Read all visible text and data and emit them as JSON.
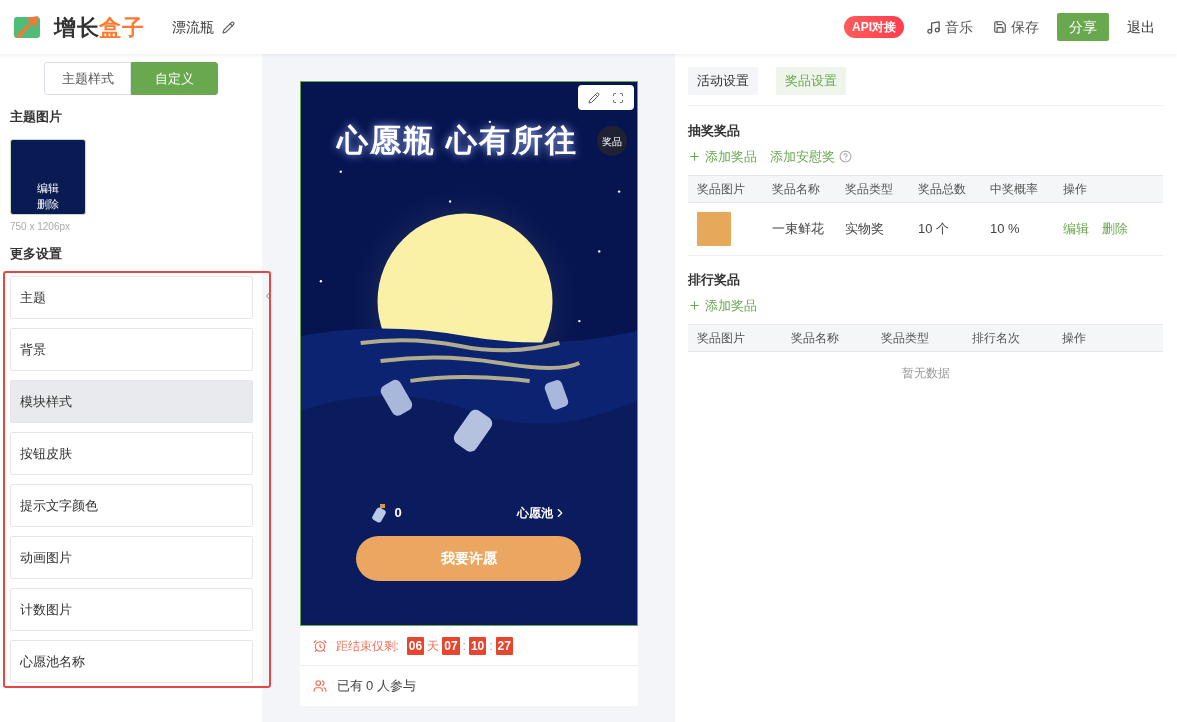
{
  "header": {
    "logo": {
      "part_1": "增长",
      "part_2": "盒子"
    },
    "project_title": "漂流瓶",
    "api_badge": "API对接",
    "music": "音乐",
    "save": "保存",
    "share": "分享",
    "exit": "退出"
  },
  "left_panel": {
    "tabs": [
      {
        "label": "主题样式",
        "selected": false
      },
      {
        "label": "自定义",
        "selected": true
      }
    ],
    "theme_image": {
      "title": "主题图片",
      "actions": [
        "编辑",
        "删除"
      ],
      "size": "750 x 1206px"
    },
    "more_settings": {
      "title": "更多设置",
      "items": [
        {
          "label": "主题",
          "selected": false
        },
        {
          "label": "背景",
          "selected": false
        },
        {
          "label": "模块样式",
          "selected": true
        },
        {
          "label": "按钮皮肤",
          "selected": false
        },
        {
          "label": "提示文字颜色",
          "selected": false
        },
        {
          "label": "动画图片",
          "selected": false
        },
        {
          "label": "计数图片",
          "selected": false
        },
        {
          "label": "心愿池名称",
          "selected": false
        }
      ]
    }
  },
  "preview": {
    "title": "心愿瓶 心有所往",
    "prize_badge": "奖品",
    "bottle_count": "0",
    "pool_link": "心愿池",
    "wish_button": "我要许愿",
    "countdown": {
      "label": "距结束仅剩:",
      "days": "06",
      "day_unit": "天",
      "hours": "07",
      "separator_1": ":",
      "minutes": "10",
      "separator_2": ":",
      "seconds": "27"
    },
    "participants": "已有 0 人参与"
  },
  "right_panel": {
    "tabs": [
      {
        "label": "活动设置",
        "selected": false
      },
      {
        "label": "奖品设置",
        "selected": true
      }
    ],
    "lottery": {
      "title": "抽奖奖品",
      "add_prize": "添加奖品",
      "add_consolation": "添加安慰奖",
      "columns": [
        "奖品图片",
        "奖品名称",
        "奖品类型",
        "奖品总数",
        "中奖概率",
        "操作"
      ],
      "rows": [
        {
          "name": "一束鲜花",
          "type": "实物奖",
          "total": "10 个",
          "probability": "10 %",
          "actions": [
            "编辑",
            "删除"
          ]
        }
      ]
    },
    "ranking": {
      "title": "排行奖品",
      "add_prize": "添加奖品",
      "columns": [
        "奖品图片",
        "奖品名称",
        "奖品类型",
        "排行名次",
        "操作"
      ],
      "empty": "暂无数据"
    }
  }
}
